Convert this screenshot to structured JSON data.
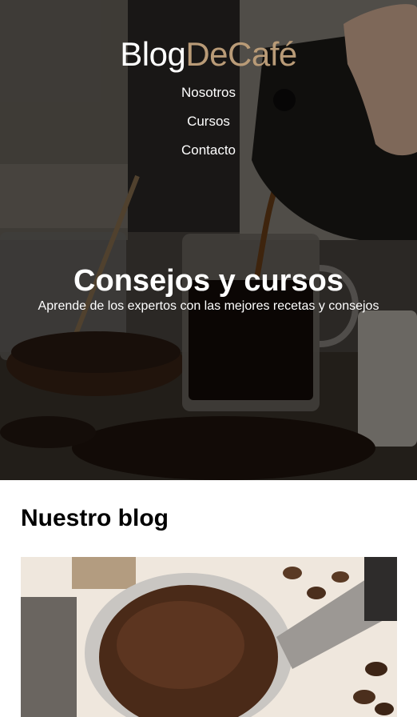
{
  "header": {
    "logo": {
      "part1": "Blog",
      "part2": "DeCafé"
    },
    "nav": [
      {
        "label": "Nosotros"
      },
      {
        "label": "Cursos"
      },
      {
        "label": "Contacto"
      }
    ]
  },
  "hero": {
    "title": "Consejos y cursos",
    "subtitle": "Aprende de los expertos con las mejores recetas y consejos"
  },
  "blog": {
    "heading": "Nuestro blog"
  },
  "colors": {
    "accent": "#b99b77",
    "text_dark": "#000000",
    "text_light": "#ffffff"
  }
}
